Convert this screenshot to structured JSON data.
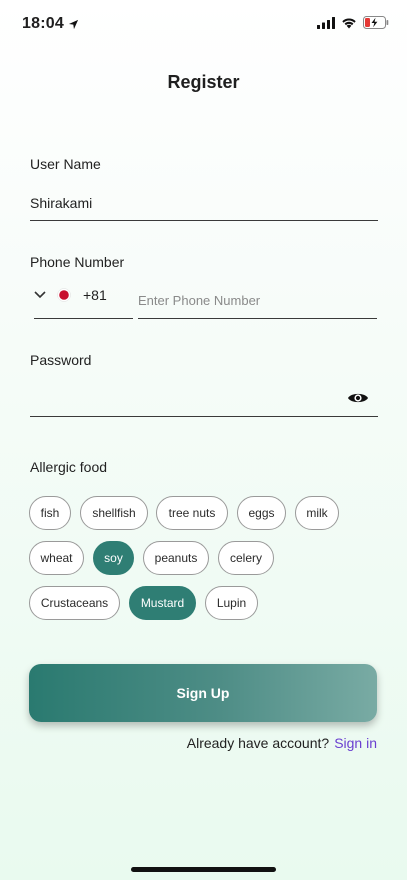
{
  "status": {
    "time": "18:04"
  },
  "title": "Register",
  "form": {
    "username": {
      "label": "User Name",
      "value": "Shirakami"
    },
    "phone": {
      "label": "Phone Number",
      "country_code": "+81",
      "placeholder": "Enter Phone Number"
    },
    "password": {
      "label": "Password",
      "value": ""
    },
    "allergy": {
      "label": "Allergic food",
      "chips": [
        {
          "label": "fish",
          "selected": false
        },
        {
          "label": "shellfish",
          "selected": false
        },
        {
          "label": "tree nuts",
          "selected": false
        },
        {
          "label": "eggs",
          "selected": false
        },
        {
          "label": "milk",
          "selected": false
        },
        {
          "label": "wheat",
          "selected": false
        },
        {
          "label": "soy",
          "selected": true
        },
        {
          "label": "peanuts",
          "selected": false
        },
        {
          "label": "celery",
          "selected": false
        },
        {
          "label": "Crustaceans",
          "selected": false
        },
        {
          "label": "Mustard",
          "selected": true
        },
        {
          "label": "Lupin",
          "selected": false
        }
      ]
    }
  },
  "actions": {
    "signup_label": "Sign Up",
    "already_text": "Already have account?",
    "signin_label": "Sign in"
  },
  "colors": {
    "accent": "#2f7e74",
    "link": "#6a3fd0",
    "flag_red": "#c8102e"
  }
}
